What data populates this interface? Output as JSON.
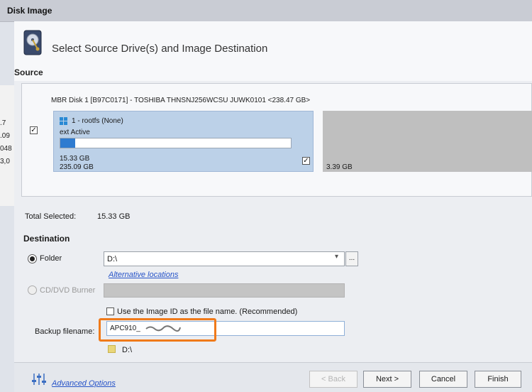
{
  "window": {
    "title": "Disk Image"
  },
  "header": {
    "title": "Select Source Drive(s) and Image Destination",
    "icon": "hard-disk-icon"
  },
  "source": {
    "label": "Source",
    "disk_line": "MBR Disk 1 [B97C0171] - TOSHIBA THNSNJ256WCSU JUWK0101  <238.47 GB>",
    "disk_checked": true,
    "partition": {
      "name": "1 - rootfs (None)",
      "status": "ext Active",
      "used": "15.33 GB",
      "total": "235.09 GB",
      "used_fraction": 0.065,
      "checked": true
    },
    "unallocated_size": "3.39 GB"
  },
  "background_numbers": [
    ".7",
    ".09",
    "048",
    "3,0"
  ],
  "total": {
    "label": "Total Selected:",
    "value": "15.33 GB"
  },
  "destination": {
    "label": "Destination",
    "folder_label": "Folder",
    "folder_selected": true,
    "folder_path": "D:\\",
    "browse_label": "...",
    "alt_locations": "Alternative locations",
    "cd_label": "CD/DVD Burner",
    "image_id_label": "Use the Image ID as the file name.  (Recommended)",
    "image_id_checked": false,
    "backup_label": "Backup filename:",
    "backup_value": "APC910_",
    "path_label": "D:\\"
  },
  "footer": {
    "advanced": "Advanced Options",
    "back": "< Back",
    "next": "Next >",
    "cancel": "Cancel",
    "finish": "Finish"
  },
  "colors": {
    "accent_blue": "#2e7bd0",
    "partition_bg": "#bcd1e8",
    "highlight": "#f07a1a"
  }
}
